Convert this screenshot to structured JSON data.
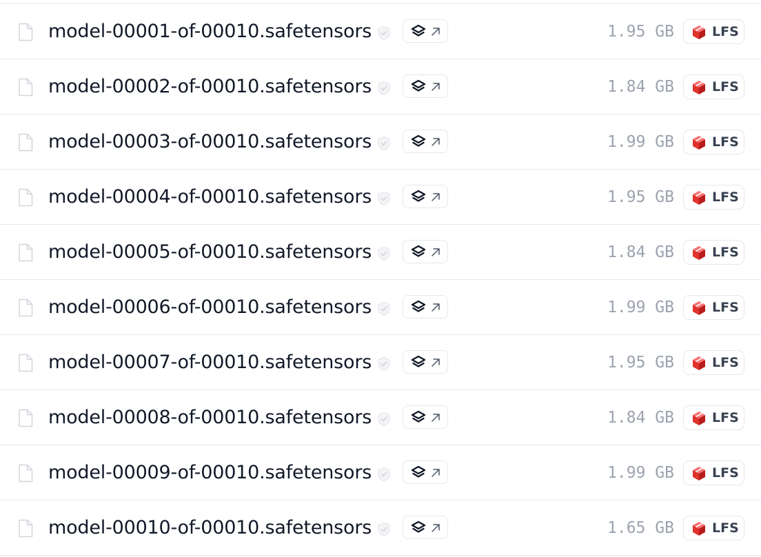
{
  "icons": {
    "file": "file-icon",
    "security_scan": "shield-icon",
    "viewer": "layers-icon",
    "open": "arrow-up-right-icon",
    "lfs": "lfs-cube-icon"
  },
  "colors": {
    "lfs_red": "#e0332b",
    "size_gray": "#9ca3af",
    "divider": "#e5e7eb"
  },
  "lfs_label": "LFS",
  "files": [
    {
      "name": "model-00001-of-00010.safetensors",
      "size": "1.95 GB"
    },
    {
      "name": "model-00002-of-00010.safetensors",
      "size": "1.84 GB"
    },
    {
      "name": "model-00003-of-00010.safetensors",
      "size": "1.99 GB"
    },
    {
      "name": "model-00004-of-00010.safetensors",
      "size": "1.95 GB"
    },
    {
      "name": "model-00005-of-00010.safetensors",
      "size": "1.84 GB"
    },
    {
      "name": "model-00006-of-00010.safetensors",
      "size": "1.99 GB"
    },
    {
      "name": "model-00007-of-00010.safetensors",
      "size": "1.95 GB"
    },
    {
      "name": "model-00008-of-00010.safetensors",
      "size": "1.84 GB"
    },
    {
      "name": "model-00009-of-00010.safetensors",
      "size": "1.99 GB"
    },
    {
      "name": "model-00010-of-00010.safetensors",
      "size": "1.65 GB"
    }
  ]
}
